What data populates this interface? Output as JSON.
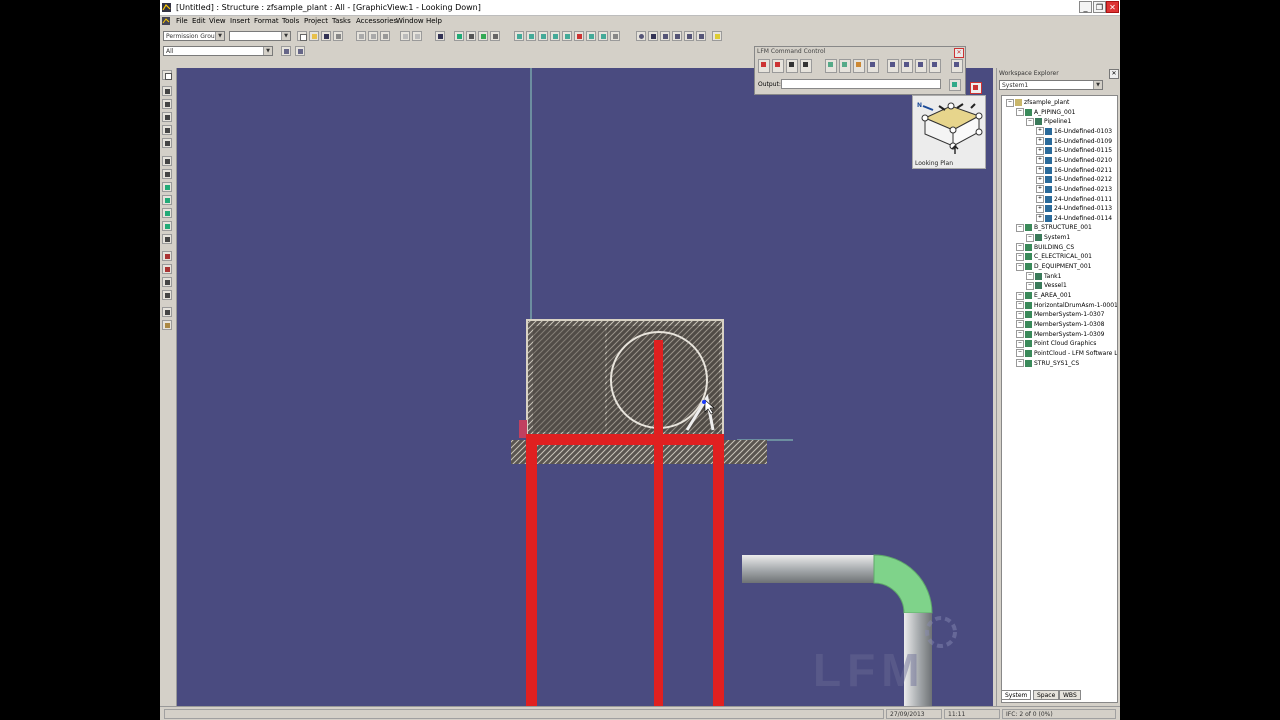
{
  "window": {
    "title": "[Untitled] : Structure : zfsample_plant : All - [GraphicView:1 - Looking Down]"
  },
  "menu": [
    "File",
    "Edit",
    "View",
    "Insert",
    "Format",
    "Tools",
    "Project",
    "Tasks",
    "Accessories",
    "Window",
    "Help"
  ],
  "toolbar": {
    "permission_group": "Permission Group",
    "permission_value": "",
    "filter_value": "All"
  },
  "lfm": {
    "title": "LFM Command Control",
    "output_label": "Output:",
    "output_value": ""
  },
  "viewcube": {
    "label": "Looking Plan",
    "north_label": "N"
  },
  "viewport": {
    "watermark": "LFM"
  },
  "explorer": {
    "title": "Workspace Explorer",
    "combo_value": "System1",
    "tree": [
      {
        "label": "zfsample_plant",
        "level": 0
      },
      {
        "label": "A_PIPING_001",
        "level": 1
      },
      {
        "label": "Pipeline1",
        "level": 2
      },
      {
        "label": "16-Undefined-0103",
        "level": 3
      },
      {
        "label": "16-Undefined-0109",
        "level": 3
      },
      {
        "label": "16-Undefined-0115",
        "level": 3
      },
      {
        "label": "16-Undefined-0210",
        "level": 3
      },
      {
        "label": "16-Undefined-0211",
        "level": 3
      },
      {
        "label": "16-Undefined-0212",
        "level": 3
      },
      {
        "label": "16-Undefined-0213",
        "level": 3
      },
      {
        "label": "24-Undefined-0111",
        "level": 3
      },
      {
        "label": "24-Undefined-0113",
        "level": 3
      },
      {
        "label": "24-Undefined-0114",
        "level": 3
      },
      {
        "label": "B_STRUCTURE_001",
        "level": 1
      },
      {
        "label": "System1",
        "level": 2
      },
      {
        "label": "BUILDING_CS",
        "level": 1
      },
      {
        "label": "C_ELECTRICAL_001",
        "level": 1
      },
      {
        "label": "D_EQUIPMENT_001",
        "level": 1
      },
      {
        "label": "Tank1",
        "level": 2
      },
      {
        "label": "Vessel1",
        "level": 2
      },
      {
        "label": "E_AREA_001",
        "level": 1
      },
      {
        "label": "HorizontalDrumAsm-1-0001",
        "level": 1
      },
      {
        "label": "MemberSystem-1-0307",
        "level": 1
      },
      {
        "label": "MemberSystem-1-0308",
        "level": 1
      },
      {
        "label": "MemberSystem-1-0309",
        "level": 1
      },
      {
        "label": "Point Cloud Graphics",
        "level": 1
      },
      {
        "label": "PointCloud - LFM Software L",
        "level": 1
      },
      {
        "label": "STRU_SYS1_CS",
        "level": 1
      }
    ],
    "tabs": [
      "System",
      "Space",
      "WBS"
    ]
  },
  "status": {
    "date": "27/09/2013",
    "time": "11:11",
    "ifc": "IFC: 2 of 0 (0%)"
  },
  "colors": {
    "viewport_bg": "#4a4b80",
    "member_red": "#e02020",
    "pipe_grey": "#a9adb0",
    "elbow_green": "#7fd38a",
    "chrome": "#d4d0c8"
  }
}
